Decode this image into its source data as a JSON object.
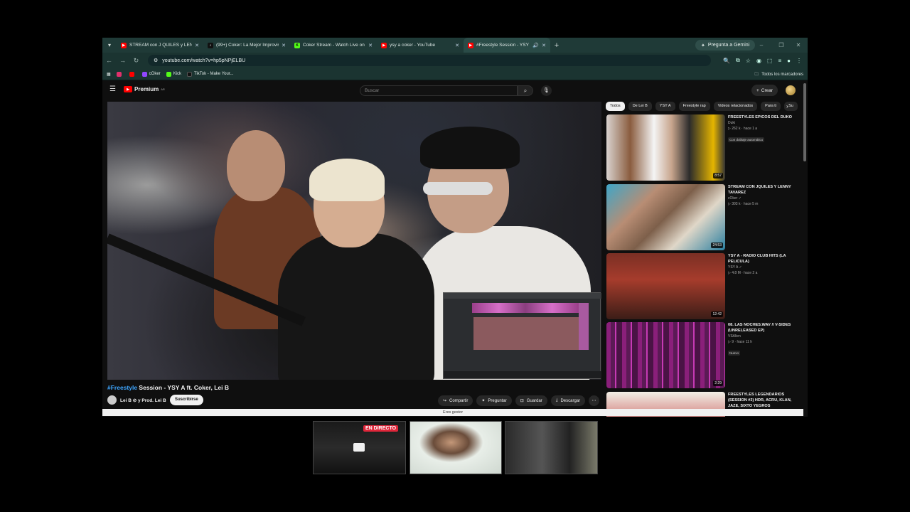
{
  "browser": {
    "tabs": [
      {
        "title": "STREAM con J QUILES y LENNY",
        "favicon": "youtube-icon",
        "color": "#ff0000"
      },
      {
        "title": "(99+) Coker: La Mejor Improvisa",
        "favicon": "tiktok-icon",
        "color": "#111111"
      },
      {
        "title": "Coker Stream - Watch Live on K",
        "favicon": "kick-icon",
        "color": "#53fc18"
      },
      {
        "title": "ysy a coker - YouTube",
        "favicon": "youtube-icon",
        "color": "#ff0000"
      },
      {
        "title": "#Freestyle Session - YSY A",
        "favicon": "youtube-icon",
        "color": "#ff0000",
        "active": true
      }
    ],
    "gemini_label": "Pregunta a Gemini",
    "url": "youtube.com/watch?v=hp5pNPjELBU",
    "bookmarks": [
      {
        "label": "",
        "icon": "instagram-icon",
        "color": "#e1306c"
      },
      {
        "label": "",
        "icon": "youtube-icon",
        "color": "#ff0000"
      },
      {
        "label": "cOker",
        "icon": "twitch-icon",
        "color": "#9146ff"
      },
      {
        "label": "Kick",
        "icon": "kick-icon",
        "color": "#53fc18"
      },
      {
        "label": "TikTok - Make Your...",
        "icon": "tiktok-icon",
        "color": "#111111"
      }
    ],
    "all_bookmarks": "Todos los marcadores",
    "status_text": "Eres gestor"
  },
  "youtube": {
    "logo_text": "Premium",
    "logo_region": "AR",
    "search_placeholder": "Buscar",
    "create_label": "Crear",
    "video": {
      "title_tag": "#Freestyle",
      "title_rest": " Session - YSY A ft. Coker, Lei B",
      "channel": "Lei B ⊘ y Prod. Lei B",
      "subscribe": "Suscribirse",
      "actions": [
        "Compartir",
        "Preguntar",
        "Guardar",
        "Descargar"
      ]
    },
    "chips": [
      "Todos",
      "De Lei B",
      "YSY A",
      "Freestyle rap",
      "Videos relacionados",
      "Para ti",
      "Su"
    ],
    "recommendations": [
      {
        "title": "FREESTYLES EPICOS DEL DUKO",
        "channel": "Duki",
        "meta": "▷ 262 k · hace 1 a",
        "badge": "Con doblaje automático",
        "duration": "8:57"
      },
      {
        "title": "STREAM CON JQUILES Y LENNY TAVAREZ",
        "channel": "cOker ✓",
        "meta": "▷ 303 k · hace 5 m",
        "badge": "",
        "duration": "24:53"
      },
      {
        "title": "YSY A - RADIO CLUB HITS (LA PELICULA)",
        "channel": "YSY A ✓",
        "meta": "▷ 4.8 M · hace 2 a",
        "badge": "",
        "duration": "12:42"
      },
      {
        "title": "08. LAS NOCHES.WAV // V-SIDES (UNRELEASED EP)",
        "channel": "VSAlien",
        "meta": "▷ 9 · hace 11 h",
        "badge": "Nuevo",
        "duration": "2:29"
      },
      {
        "title": "FREESTYLES LEGENDARIOS (SESSION #3) HDR, ACRU, KLAN, JAZE, SIXTO YEGROS",
        "channel": "",
        "meta": "",
        "badge": "",
        "duration": ""
      }
    ]
  },
  "previews": {
    "live_label": "EN DIRECTO"
  }
}
